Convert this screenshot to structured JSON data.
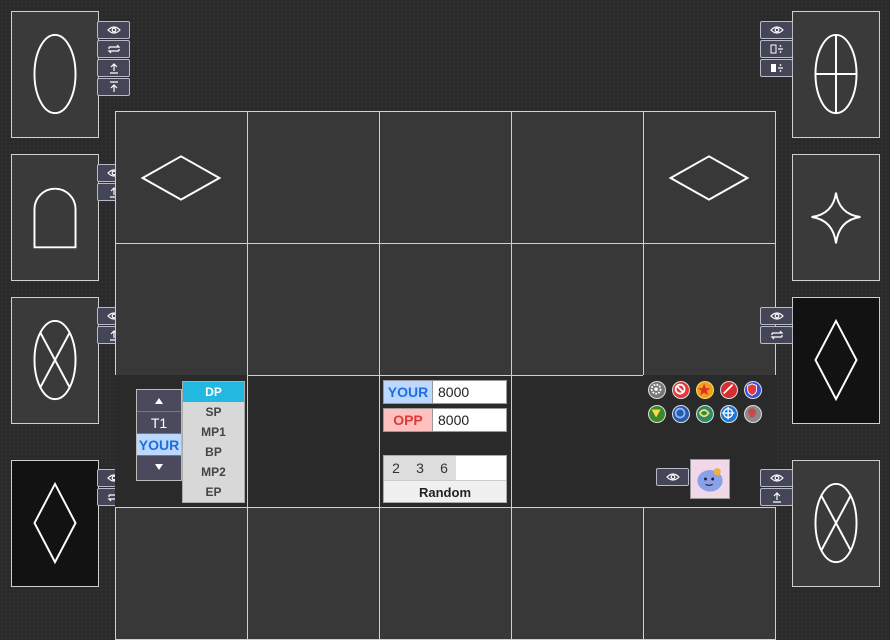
{
  "life_points": {
    "your_label": "YOUR",
    "your_value": "8000",
    "opp_label": "OPP",
    "opp_value": "8000"
  },
  "turn": {
    "turn_label": "T1",
    "player_label": "YOUR"
  },
  "phases": [
    "DP",
    "SP",
    "MP1",
    "BP",
    "MP2",
    "EP"
  ],
  "active_phase": "DP",
  "dice": {
    "values": [
      "2",
      "3",
      "6"
    ],
    "random_label": "Random"
  },
  "colors": {
    "your_accent": "#1d6fe0",
    "opp_accent": "#e03a3a",
    "active_phase": "#22b8e0"
  },
  "icons": {
    "zone_buttons": [
      "eye-icon",
      "swap-icon",
      "upload-icon",
      "top-upload-icon"
    ],
    "counter_tokens": [
      "gear-token",
      "prohibit-token",
      "star-token",
      "sword-token",
      "shield-token",
      "leaf-token",
      "ring-token",
      "swirl-token",
      "crosshair-token",
      "skull-token"
    ]
  }
}
